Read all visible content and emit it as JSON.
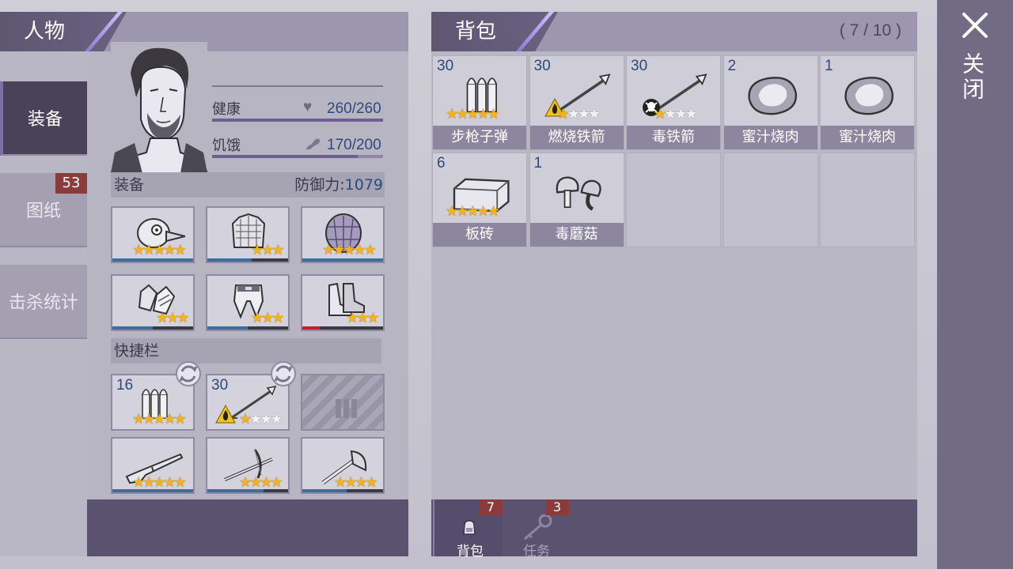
{
  "character": {
    "title": "人物",
    "side_tabs": [
      {
        "label": "装备",
        "active": true
      },
      {
        "label": "图纸",
        "badge": "53"
      },
      {
        "label": "击杀统计"
      }
    ],
    "stats": {
      "health_label": "健康",
      "health_value": "260/260",
      "health_fraction": 1.0,
      "hunger_label": "饥饿",
      "hunger_value": "170/200",
      "hunger_fraction": 0.85
    },
    "equipment_label": "装备",
    "defense_label": "防御力:",
    "defense_value": "1079",
    "equipment": [
      {
        "icon": "bird-mask-icon",
        "stars": 5,
        "max_stars": 5,
        "durability": 1.0
      },
      {
        "icon": "chest-armor-icon",
        "stars": 3,
        "max_stars": 3,
        "durability": 0.55
      },
      {
        "icon": "turtle-shell-icon",
        "stars": 5,
        "max_stars": 5,
        "durability": 1.0
      },
      {
        "icon": "gloves-icon",
        "stars": 3,
        "max_stars": 3,
        "durability": 0.5
      },
      {
        "icon": "leg-armor-icon",
        "stars": 3,
        "max_stars": 3,
        "durability": 0.5
      },
      {
        "icon": "boots-icon",
        "stars": 3,
        "max_stars": 3,
        "durability": 0.22,
        "durability_color": "#c0212a"
      }
    ],
    "hotbar_label": "快捷栏",
    "hotbar": [
      {
        "icon": "rifle-bullets-icon",
        "qty": "16",
        "stars": 5,
        "max_stars": 5,
        "swap": true
      },
      {
        "icon": "fire-arrow-icon",
        "qty": "30",
        "stars": 1,
        "max_stars": 4,
        "swap": true,
        "fire": true
      },
      {
        "icon": "empty-ammo-slot-icon",
        "locked": true
      },
      {
        "icon": "rifle-icon",
        "stars": 5,
        "max_stars": 5,
        "durability": 1.0
      },
      {
        "icon": "crossbow-icon",
        "stars": 4,
        "max_stars": 4,
        "durability": 0.7
      },
      {
        "icon": "axe-icon",
        "stars": 4,
        "max_stars": 4,
        "durability": 0.55
      }
    ]
  },
  "backpack": {
    "title": "背包",
    "count": "( 7 / 10 )",
    "items": [
      {
        "name": "步枪子弹",
        "qty": "30",
        "icon": "rifle-bullets-icon",
        "stars": 5,
        "max_stars": 5
      },
      {
        "name": "燃烧铁箭",
        "qty": "30",
        "icon": "fire-arrow-icon",
        "stars": 1,
        "max_stars": 4,
        "badge": "fire"
      },
      {
        "name": "毒铁箭",
        "qty": "30",
        "icon": "poison-arrow-icon",
        "stars": 1,
        "max_stars": 4,
        "badge": "skull"
      },
      {
        "name": "蜜汁烧肉",
        "qty": "2",
        "icon": "roast-meat-icon"
      },
      {
        "name": "蜜汁烧肉",
        "qty": "1",
        "icon": "roast-meat-icon"
      },
      {
        "name": "板砖",
        "qty": "6",
        "icon": "brick-icon",
        "stars": 5,
        "max_stars": 5
      },
      {
        "name": "毒蘑菇",
        "qty": "1",
        "icon": "mushroom-icon"
      }
    ],
    "empty_slots": 3,
    "tabs": [
      {
        "label": "背包",
        "badge": "7",
        "icon": "backpack-icon"
      },
      {
        "label": "任务",
        "badge": "3",
        "icon": "key-icon"
      }
    ]
  },
  "close": {
    "label": "关闭"
  },
  "colors": {
    "accent": "#5f5672",
    "quantity": "#2c4a7c",
    "badge": "#8a3c3c",
    "star": "#f2b31c"
  }
}
